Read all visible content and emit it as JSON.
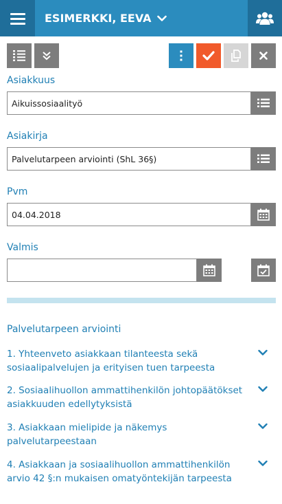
{
  "header": {
    "title": "ESIMERKKI, EEVA",
    "menu_icon": "hamburger-icon",
    "user_icon": "users-icon",
    "chevron_icon": "chevron-down-icon"
  },
  "toolbar": {
    "icons": [
      "list-numbered-icon",
      "double-chevron-down-icon",
      "vertical-ellipsis-icon",
      "checkmark-icon",
      "copy-icon",
      "close-icon"
    ]
  },
  "form": {
    "asiakkuus": {
      "label": "Asiakkuus",
      "value": "Aikuissosiaalityö"
    },
    "asiakirja": {
      "label": "Asiakirja",
      "value": "Palvelutarpeen arviointi (ShL 36§)"
    },
    "pvm": {
      "label": "Pvm",
      "value": "04.04.2018"
    },
    "valmis": {
      "label": "Valmis",
      "value": ""
    }
  },
  "section": {
    "title": "Palvelutarpeen arviointi",
    "items": [
      {
        "label": "1. Yhteenveto asiakkaan tilanteesta sekä sosiaalipalvelujen ja erityisen tuen tarpeesta"
      },
      {
        "label": "2. Sosiaalihuollon ammattihenkilön johtopäätökset asiakkuuden edellytyksistä"
      },
      {
        "label": "3. Asiakkaan mielipide ja näkemys palvelutarpeestaan"
      },
      {
        "label": "4. Asiakkaan ja sosiaalihuollon ammattihenkilön arvio 42 §:n mukaisen omatyöntekijän tarpeesta"
      }
    ]
  },
  "colors": {
    "primary": "#2b8cbe",
    "primary_dark": "#1f6e9a",
    "accent": "#f15a2b",
    "button_gray": "#7d7d7d",
    "progress": "#c4e3ef"
  }
}
